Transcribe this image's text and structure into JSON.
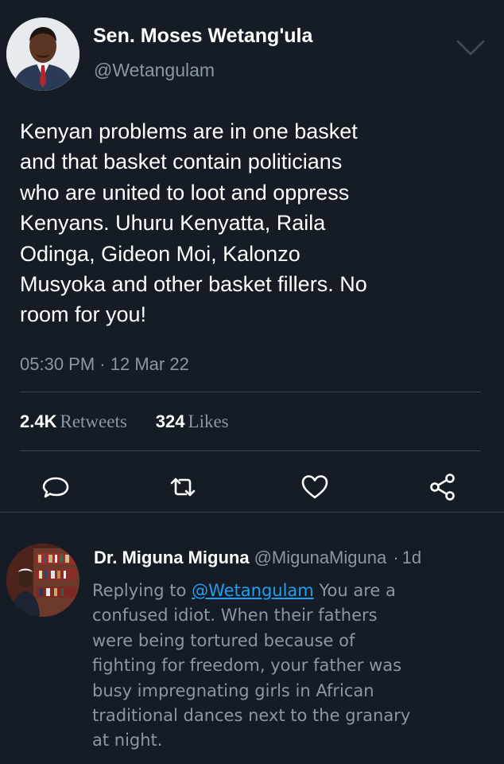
{
  "tweet": {
    "author_name": "Sen. Moses Wetang'ula",
    "author_handle": "@Wetangulam",
    "text_lines": [
      "Kenyan problems are in one basket",
      "and that basket contain politicians",
      "who are united to loot and oppress",
      "Kenyans. Uhuru Kenyatta, Raila",
      "Odinga, Gideon Moi, Kalonzo",
      "Musyoka and other basket fillers. No",
      "room for you!"
    ],
    "time": "05:30 PM",
    "separator": "·",
    "date": "12 Mar 22",
    "retweets_count": "2.4K",
    "retweets_label": "Retweets",
    "likes_count": "324",
    "likes_label": "Likes",
    "menu_icon": "chevron-down-icon"
  },
  "actions": [
    {
      "name": "reply-button",
      "icon": "comment-icon"
    },
    {
      "name": "retweet-button",
      "icon": "retweet-icon"
    },
    {
      "name": "like-button",
      "icon": "heart-icon"
    },
    {
      "name": "share-button",
      "icon": "share-icon"
    }
  ],
  "reply": {
    "author_name": "Dr. Miguna Miguna",
    "author_handle": "@MigunaMiguna",
    "separator": "·",
    "time_ago": "1d",
    "replying_prefix": "Replying to",
    "replying_to": "@Wetangulam",
    "first_line_rest": "You are a",
    "body_lines": [
      "confused idiot. When their fathers",
      "were being tortured because of",
      "fighting for freedom, your father was",
      "busy impregnating girls in African",
      "traditional dances next to the granary",
      "at night."
    ]
  },
  "colors": {
    "background": "#151c25",
    "text": "#ffffff",
    "muted": "#8a97a4",
    "link": "#1da1f2",
    "divider": "#3a4552"
  }
}
